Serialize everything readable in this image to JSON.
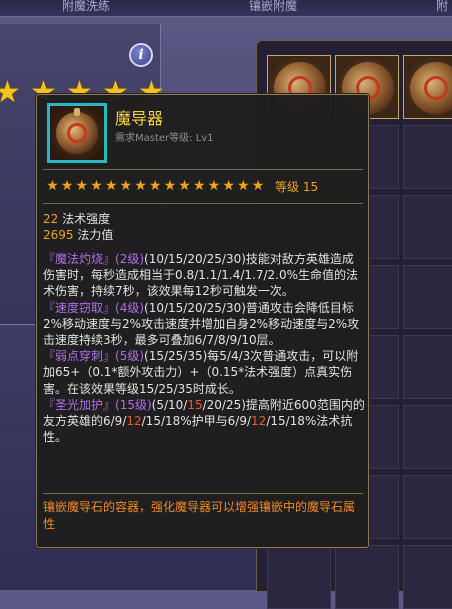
{
  "tabs": [
    "附魔洗练",
    "镶嵌附魔",
    "附"
  ],
  "background_stars": 5,
  "info_icon": "i",
  "tooltip": {
    "item_name": "魔导器",
    "requirement": "需求Master等级: Lv1",
    "star_count": 15,
    "level_label": "等级 15",
    "stats": [
      {
        "value": "22",
        "label": "法术强度"
      },
      {
        "value": "2695",
        "label": "法力值"
      }
    ],
    "skills": [
      {
        "name": "『魔法灼烧』",
        "level": "(2级)",
        "desc": "(10/15/20/25/30)技能对敌方英雄造成伤害时，每秒造成相当于0.8/1.1/1.4/1.7/2.0%生命值的法术伤害，持续7秒，该效果每12秒可触发一次。"
      },
      {
        "name": "『速度窃取』",
        "level": "(4级)",
        "desc": "(10/15/20/25/30)普通攻击会降低目标2%移动速度与2%攻击速度并增加自身2%移动速度与2%攻击速度持续3秒，最多可叠加6/7/8/9/10层。"
      },
      {
        "name": "『弱点穿刺』",
        "level": "(5级)",
        "desc": "(15/25/35)每5/4/3次普通攻击，可以附加65+（0.1*额外攻击力）+（0.15*法术强度）点真实伤害。在该效果等级15/25/35时成长。"
      },
      {
        "name": "『圣光加护』",
        "level": "(15级)",
        "desc_parts": [
          "(5/10/",
          "15",
          "/20/25)提高附近600范围内的友方英雄的6/9/",
          "12",
          "/15/18%护甲与6/9/",
          "12",
          "/15/18%法术抗性。"
        ]
      }
    ],
    "description": "镶嵌魔导石的容器，强化魔导器可以增强镶嵌中的魔导石属性"
  },
  "colors": {
    "name": "#f6d53b",
    "accent": "#f0a41c",
    "skill": "#b070e8",
    "highlight": "#f05a2a",
    "footer": "#f28a24",
    "icon_border": "#29b7c4"
  },
  "icons": [
    "info-icon",
    "magic-device-icon",
    "star-icon"
  ]
}
